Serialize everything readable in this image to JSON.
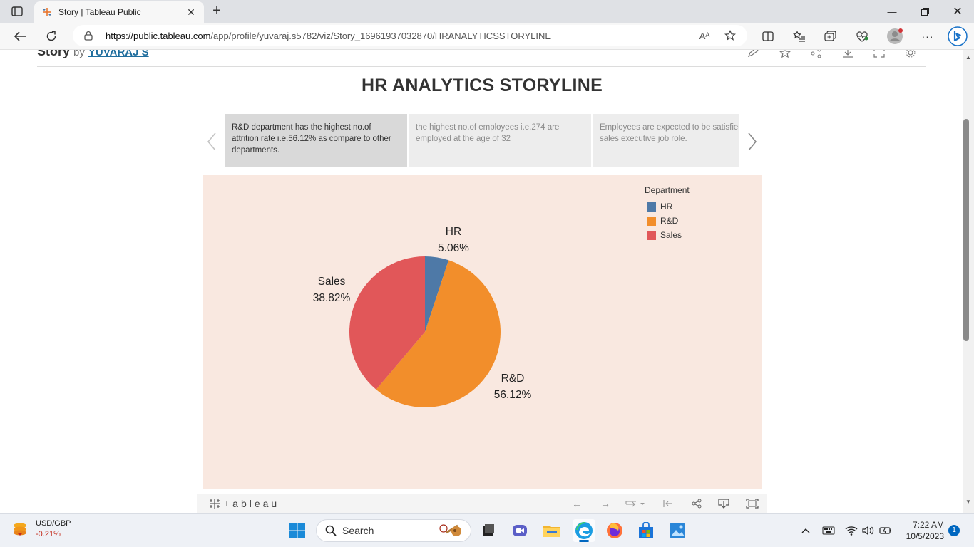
{
  "browser": {
    "tab_title": "Story | Tableau Public",
    "url_host": "https://public.tableau.com",
    "url_path": "/app/profile/yuvaraj.s5782/viz/Story_16961937032870/HRANALYTICSSTORYLINE",
    "read_aloud_label": "Aᴬ"
  },
  "page": {
    "story_label": "Story",
    "by_label": "by",
    "author": "YUVARAJ S",
    "story_title": "HR ANALYTICS STORYLINE",
    "story_points": [
      {
        "text": "R&D department has the highest no.of attrition rate i.e.56.12% as compare to other departments."
      },
      {
        "text": "the highest no.of employees i.e.274 are employed at the age of 32"
      },
      {
        "text": "Employees are expected to be satisfied in sales executive job role."
      }
    ],
    "tableau_wordmark": "+ableau"
  },
  "chart_data": {
    "type": "pie",
    "legend_title": "Department",
    "legend_position": "top-right",
    "categories": [
      "HR",
      "R&D",
      "Sales"
    ],
    "values": [
      5.06,
      56.12,
      38.82
    ],
    "labels": [
      "5.06%",
      "56.12%",
      "38.82%"
    ],
    "colors": [
      "#4e79a7",
      "#f28e2b",
      "#e15759"
    ],
    "background": "#f9e8e0"
  },
  "taskbar": {
    "ticker_name": "USD/GBP",
    "ticker_change": "-0.21%",
    "search_label": "Search",
    "time": "7:22 AM",
    "date": "10/5/2023",
    "notification_count": "1"
  }
}
